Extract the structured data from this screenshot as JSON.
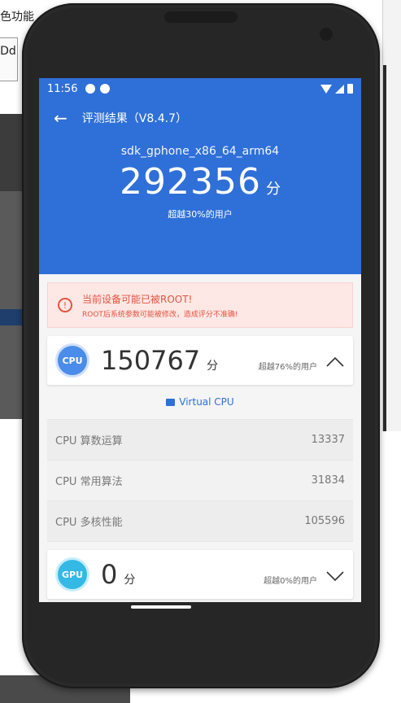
{
  "background": {
    "label_fragment": "色功能",
    "button_fragment": "Dd"
  },
  "status_bar": {
    "time": "11:56"
  },
  "app_bar": {
    "title": "评测结果（V8.4.7）",
    "back_icon": "arrow-left-icon"
  },
  "summary": {
    "device": "sdk_gphone_x86_64_arm64",
    "total_score": "292356",
    "unit": "分",
    "beyond": "超越30%的用户"
  },
  "warning": {
    "title": "当前设备可能已被ROOT!",
    "detail": "ROOT后系统参数可能被修改，造成评分不准确!"
  },
  "cpu": {
    "badge": "CPU",
    "score": "150767",
    "unit": "分",
    "beyond": "超越76%的用户",
    "virtual_label": "Virtual CPU",
    "rows": [
      {
        "label": "CPU 算数运算",
        "value": "13337"
      },
      {
        "label": "CPU 常用算法",
        "value": "31834"
      },
      {
        "label": "CPU 多核性能",
        "value": "105596"
      }
    ]
  },
  "gpu": {
    "badge": "GPU",
    "score": "0",
    "unit": "分",
    "beyond": "超越0%的用户"
  },
  "colors": {
    "primary": "#2f6fd8",
    "warning": "#e5533f",
    "warning_bg": "#fde8e6"
  }
}
